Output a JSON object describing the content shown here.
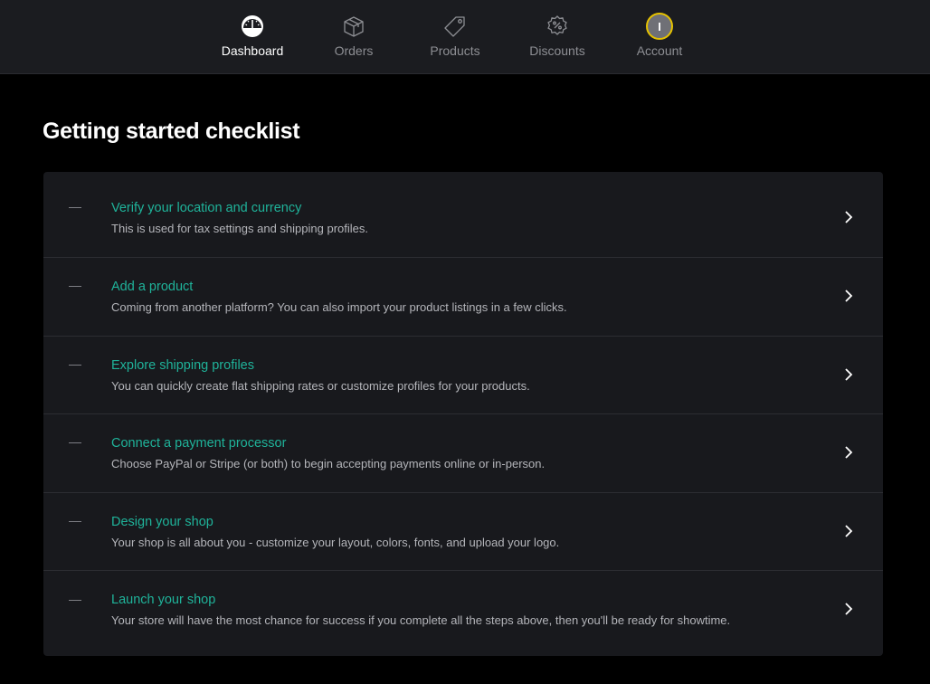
{
  "nav": {
    "items": [
      {
        "label": "Dashboard",
        "icon": "dashboard-gauge-icon",
        "active": true
      },
      {
        "label": "Orders",
        "icon": "box-icon",
        "active": false
      },
      {
        "label": "Products",
        "icon": "tag-icon",
        "active": false
      },
      {
        "label": "Discounts",
        "icon": "percent-badge-icon",
        "active": false
      },
      {
        "label": "Account",
        "icon": "avatar",
        "active": false
      }
    ],
    "account_initial": "I"
  },
  "page": {
    "title": "Getting started checklist"
  },
  "checklist": {
    "items": [
      {
        "title": "Verify your location and currency",
        "description": "This is used for tax settings and shipping profiles."
      },
      {
        "title": "Add a product",
        "description": "Coming from another platform? You can also import your product listings in a few clicks."
      },
      {
        "title": "Explore shipping profiles",
        "description": "You can quickly create flat shipping rates or customize profiles for your products."
      },
      {
        "title": "Connect a payment processor",
        "description": "Choose PayPal or Stripe (or both) to begin accepting payments online or in-person."
      },
      {
        "title": "Design your shop",
        "description": "Your shop is all about you - customize your layout, colors, fonts, and upload your logo."
      },
      {
        "title": "Launch your shop",
        "description": "Your store will have the most chance for success if you complete all the steps above, then you'll be ready for showtime."
      }
    ]
  },
  "colors": {
    "accent": "#1fb39a",
    "nav_bg": "#1b1c20",
    "panel_bg": "#18191d",
    "page_bg": "#000000",
    "avatar_ring": "#e6c200"
  }
}
